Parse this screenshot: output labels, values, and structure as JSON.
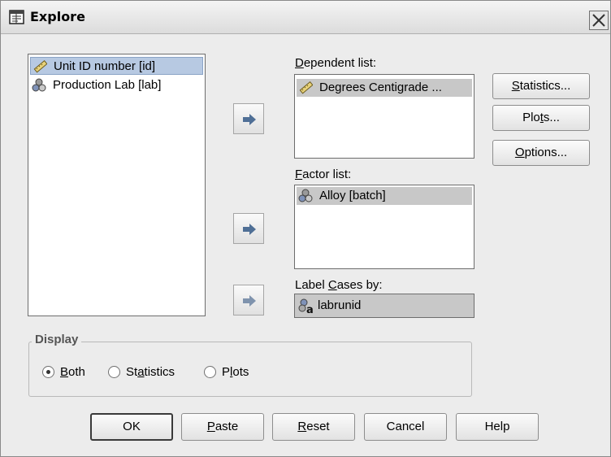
{
  "window": {
    "title": "Explore"
  },
  "source_list": {
    "items": [
      {
        "label": "Unit ID number [id]",
        "icon": "ruler-icon"
      },
      {
        "label": "Production Lab [lab]",
        "icon": "nominal-variable-icon"
      }
    ]
  },
  "dependent": {
    "label_u": "D",
    "label_rest": "ependent list:",
    "item": "Degrees Centigrade ..."
  },
  "factor": {
    "label_u": "F",
    "label_rest": "actor list:",
    "item": "Alloy [batch]"
  },
  "label_cases": {
    "label_pre": "Label ",
    "label_u": "C",
    "label_rest": "ases by:",
    "item": "labrunid"
  },
  "side_buttons": {
    "statistics": {
      "u": "S",
      "rest": "tatistics..."
    },
    "plots": {
      "pre": "Plo",
      "u": "t",
      "rest": "s..."
    },
    "options": {
      "u": "O",
      "rest": "ptions..."
    }
  },
  "display": {
    "legend": "Display",
    "both": {
      "u": "B",
      "rest": "oth",
      "selected": true
    },
    "statistics": {
      "pre": "St",
      "u": "a",
      "rest": "tistics"
    },
    "plots": {
      "pre": "P",
      "u": "l",
      "rest": "ots"
    }
  },
  "buttons": {
    "ok": "OK",
    "paste": {
      "u": "P",
      "rest": "aste"
    },
    "reset": {
      "u": "R",
      "rest": "eset"
    },
    "cancel": "Cancel",
    "help": "Help"
  }
}
